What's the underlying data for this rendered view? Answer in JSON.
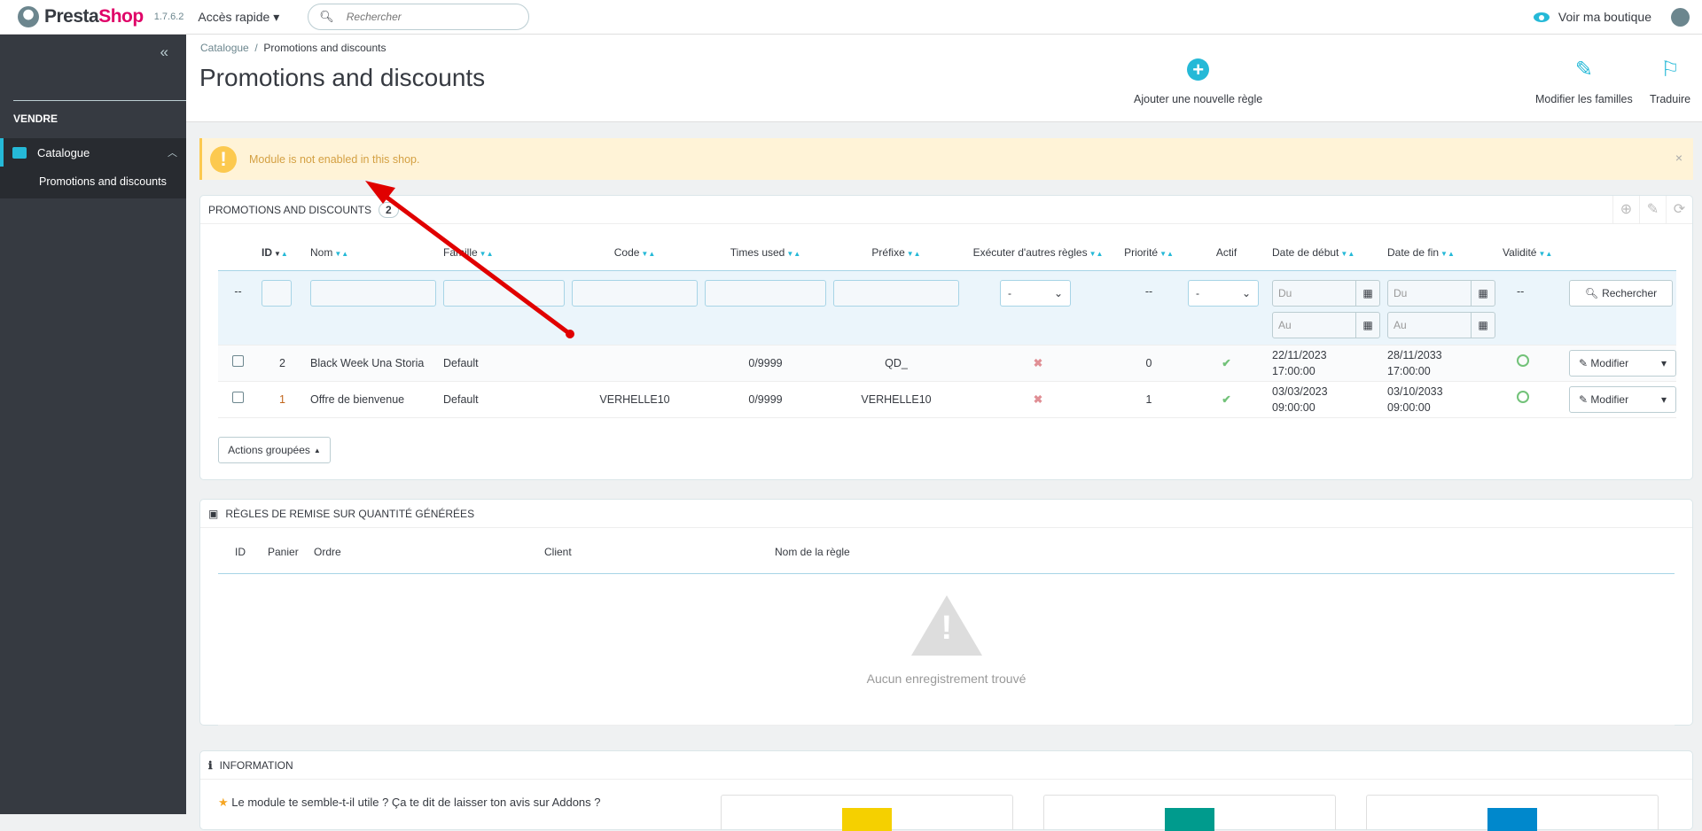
{
  "topbar": {
    "brand_a": "Presta",
    "brand_b": "Shop",
    "version": "1.7.6.2",
    "quick_access": "Accès rapide",
    "search_placeholder": "Rechercher",
    "view_shop": "Voir ma boutique"
  },
  "sidebar": {
    "section": "VENDRE",
    "items": [
      {
        "label": "Catalogue"
      }
    ],
    "subitems": [
      {
        "label": "Promotions and discounts"
      }
    ]
  },
  "header": {
    "breadcrumb": [
      "Catalogue",
      "Promotions and discounts"
    ],
    "title": "Promotions and discounts",
    "toolbar": [
      "Ajouter une nouvelle règle",
      "Modifier les familles",
      "Traduire"
    ]
  },
  "alert": {
    "message": "Module is not enabled in this shop.",
    "close": "×"
  },
  "list": {
    "title": "Promotions and discounts",
    "count": "2",
    "columns": [
      "ID",
      "Nom",
      "Famille",
      "Code",
      "Times used",
      "Préfixe",
      "Exécuter d'autres règles",
      "Priorité",
      "Actif",
      "Date de début",
      "Date de fin",
      "Validité"
    ],
    "filter": {
      "dash": "--",
      "select_default": "-",
      "from": "Du",
      "to": "Au",
      "search_button": "Rechercher"
    },
    "rows": [
      {
        "id": "2",
        "name": "Black Week Una Storia",
        "family": "Default",
        "code": "",
        "times_used": "0/9999",
        "prefix": "QD_",
        "run_other": "no",
        "priority": "0",
        "active": "yes",
        "start_date": "22/11/2023",
        "start_time": "17:00:00",
        "end_date": "28/11/2033",
        "end_time": "17:00:00",
        "edit": "Modifier"
      },
      {
        "id": "1",
        "name": "Offre de bienvenue",
        "family": "Default",
        "code": "VERHELLE10",
        "times_used": "0/9999",
        "prefix": "VERHELLE10",
        "run_other": "no",
        "priority": "1",
        "active": "yes",
        "start_date": "03/03/2023",
        "start_time": "09:00:00",
        "end_date": "03/10/2033",
        "end_time": "09:00:00",
        "edit": "Modifier"
      }
    ],
    "bulk": "Actions groupées"
  },
  "generated": {
    "title": "Règles de remise sur quantité générées",
    "columns": [
      "ID",
      "Panier",
      "Ordre",
      "Client",
      "Nom de la règle"
    ],
    "empty": "Aucun enregistrement trouvé"
  },
  "info": {
    "title": "Information",
    "text": "Le module te semble-t-il utile ? Ça te dit de laisser ton avis sur Addons ?"
  },
  "colors": {
    "accent": "#25b9d7",
    "sidebar": "#363a41",
    "warning": "#fcc94f",
    "arrow": "#e00000"
  }
}
